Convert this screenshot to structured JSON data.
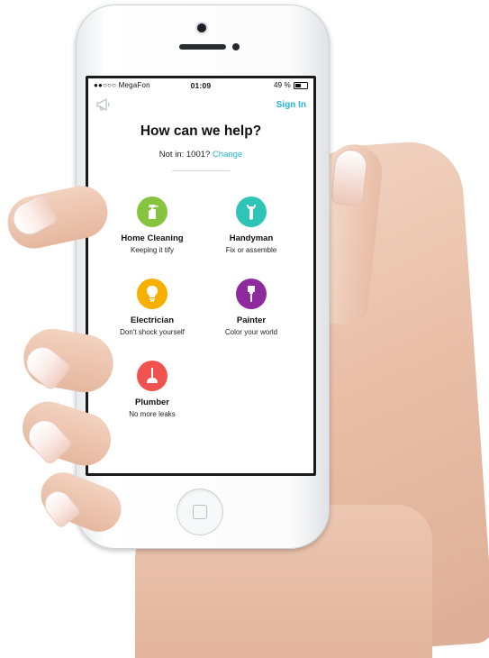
{
  "status_bar": {
    "carrier": "●●○○○ MegaFon",
    "time": "01:09",
    "battery": "49 %",
    "battery_level": 0.49
  },
  "header": {
    "announcement_icon": "megaphone-icon",
    "signin_label": "Sign In"
  },
  "main": {
    "title": "How can we help?",
    "location_prefix": "Not in: 1001?",
    "location_change": "Change"
  },
  "services": [
    {
      "name": "Home Cleaning",
      "desc": "Keeping it tify",
      "icon": "spray-bottle-icon",
      "color": "#86c440"
    },
    {
      "name": "Handyman",
      "desc": "Fix or assemble",
      "icon": "wrench-icon",
      "color": "#2ec4b6"
    },
    {
      "name": "Electrician",
      "desc": "Don't shock yourself",
      "icon": "lightbulb-icon",
      "color": "#f7b000"
    },
    {
      "name": "Painter",
      "desc": "Color your world",
      "icon": "paint-roller-icon",
      "color": "#8e2a9e"
    },
    {
      "name": "Plumber",
      "desc": "No more leaks",
      "icon": "plunger-icon",
      "color": "#f0534f"
    }
  ],
  "colors": {
    "accent": "#1fb8d6"
  }
}
